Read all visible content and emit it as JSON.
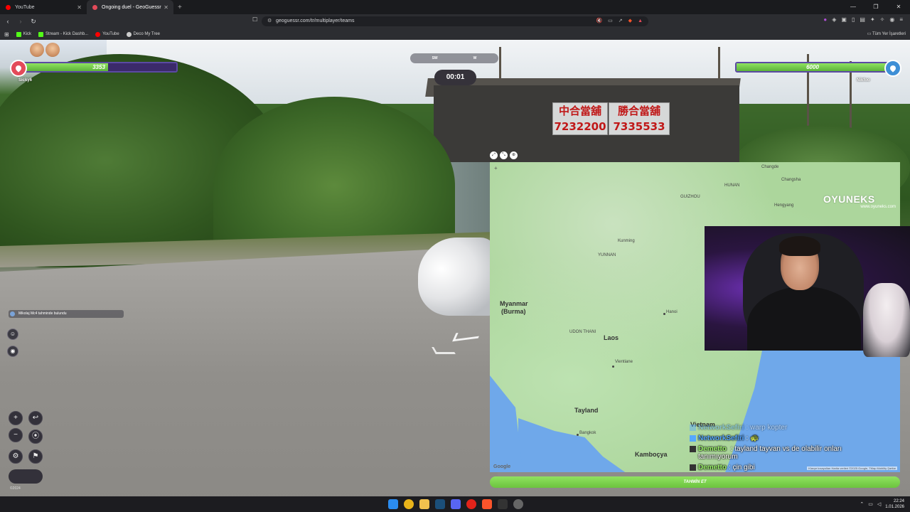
{
  "browser": {
    "tabs": [
      {
        "label": "YouTube",
        "active": false,
        "favicon_color": "#ff0000"
      },
      {
        "label": "Ongoing duel - GeoGuessr",
        "active": true,
        "favicon_color": "#e34a59"
      }
    ],
    "url": "geoguessr.com/tr/multiplayer/teams",
    "bookmarks": [
      {
        "label": "Kick",
        "icon_color": "#53fc18"
      },
      {
        "label": "Stream - Kick Dashb...",
        "icon_color": "#53fc18"
      },
      {
        "label": "YouTube",
        "icon_color": "#ff0000"
      },
      {
        "label": "Deco My Tree",
        "icon_color": "#cccccc"
      }
    ],
    "bookmarks_right": "Tüm Yer İşaretleri"
  },
  "game": {
    "left_player": {
      "name": "Sicky6",
      "score": "3353",
      "health_fraction": 0.56
    },
    "right_player": {
      "name": "Nikfoo",
      "score": "6000",
      "health_fraction": 1.0
    },
    "compass": [
      "SW",
      "W"
    ],
    "timer": "00:01",
    "guess_notice": "Mikolaj Mc4 tahminde bulundu",
    "guess_button": "TAHMİN ET",
    "map_controls": {
      "zoom_in": "+",
      "zoom_out": "−",
      "undo": "↩"
    },
    "watermark": "©2024"
  },
  "map": {
    "labels": [
      {
        "text": "Myanmar",
        "sub": "(Burma)"
      },
      {
        "text": "Laos"
      },
      {
        "text": "Tayland"
      },
      {
        "text": "Vietnam"
      },
      {
        "text": "Kamboçya"
      }
    ],
    "small_labels": [
      "HUNAN",
      "GUIZHOU",
      "YUNNAN",
      "Changde",
      "Changsha",
      "Hengyang",
      "Kunming",
      "Hanoi",
      "Vientiane",
      "Bangkok",
      "UDON THANI"
    ],
    "watermark": "Google",
    "attribution": "Klavye kısayolları   Harita verileri ©2025 Google, TMap Mobility   Şartlar",
    "sponsor": {
      "name": "OYUNEKS",
      "site": "www.oyuneks.com"
    }
  },
  "chat": [
    {
      "user": "NetworkSefiri",
      "message": ": warp kopter",
      "color": "blue",
      "faded": true
    },
    {
      "user": "NetworkSefiri",
      "message": ": 🐢",
      "color": "blue",
      "faded": false
    },
    {
      "user": "Demetto",
      "message": ": tayland tayvan vs de olabilir onları tanımıyorum",
      "color": "green",
      "faded": false
    },
    {
      "user": "Demetto",
      "message": ": çin gibi",
      "color": "green",
      "faded": false
    }
  ],
  "taskbar": {
    "time": "22:24",
    "date": "1.01.2026"
  }
}
